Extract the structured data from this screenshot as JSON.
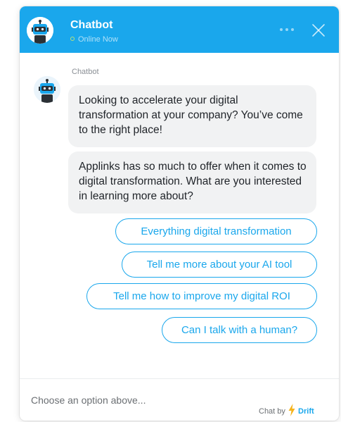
{
  "header": {
    "title": "Chatbot",
    "status": "Online Now",
    "accent_color": "#1aa7ec",
    "status_color": "#b7e27a",
    "avatar_icon": "robot-icon",
    "menu_icon": "ellipsis-icon",
    "close_icon": "close-icon"
  },
  "conversation": {
    "sender": "Chatbot",
    "messages": [
      "Looking to accelerate your digital transformation at your company? You’ve come to the right place!",
      "Applinks has so much to offer when it comes to digital transformation. What are you interested in learning more about?"
    ],
    "options": [
      "Everything digital transformation",
      "Tell me more about your AI tool",
      "Tell me how to improve my digital ROI",
      "Can I talk with a human?"
    ]
  },
  "composer": {
    "placeholder": "Choose an option above..."
  },
  "branding": {
    "prefix": "Chat by",
    "brand": "Drift",
    "icon": "lightning-bolt-icon"
  }
}
